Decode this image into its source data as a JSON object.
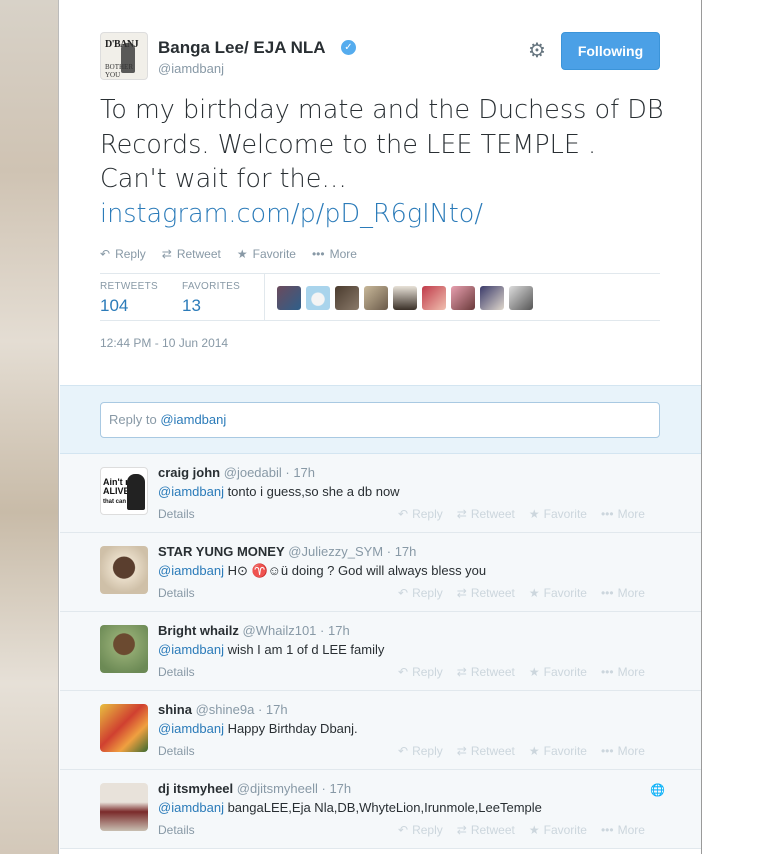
{
  "tweet": {
    "author_name": "Banga Lee/ EJA NLA",
    "author_handle": "@iamdbanj",
    "avatar_text_top": "D'BANJ",
    "avatar_text_bottom": "BOTHER YOU",
    "follow_label": "Following",
    "text_before_link": "To my birthday mate and the Duchess of DB Records. Welcome to the LEE TEMPLE . Can't wait for the… ",
    "link_text": "instagram.com/p/pD_R6gINto/",
    "actions": [
      {
        "icon": "reply-icon",
        "glyph": "↶",
        "label": "Reply"
      },
      {
        "icon": "retweet-icon",
        "glyph": "⇄",
        "label": "Retweet"
      },
      {
        "icon": "star-icon",
        "glyph": "★",
        "label": "Favorite"
      },
      {
        "icon": "more-icon",
        "glyph": "•••",
        "label": "More"
      }
    ],
    "retweets_label": "RETWEETS",
    "retweets_count": "104",
    "favorites_label": "FAVORITES",
    "favorites_count": "13",
    "timestamp": "12:44 PM - 10 Jun 2014"
  },
  "reply_box": {
    "prefix": "Reply to ",
    "mention": "@iamdbanj"
  },
  "replies": [
    {
      "name": "craig john",
      "handle": "@joedabil",
      "time": "17h",
      "mention": "@iamdbanj",
      "text": " tonto i guess,so she a db now",
      "details": "Details"
    },
    {
      "name": "STAR YUNG MONEY",
      "handle": "@Juliezzy_SYM",
      "time": "17h",
      "mention": "@iamdbanj",
      "text": " H⊙ ♈☺ü doing ? God will always bless you",
      "details": "Details"
    },
    {
      "name": "Bright whailz",
      "handle": "@Whailz101",
      "time": "17h",
      "mention": "@iamdbanj",
      "text": " wish I am 1 of d LEE family",
      "details": "Details"
    },
    {
      "name": "shina",
      "handle": "@shine9a",
      "time": "17h",
      "mention": "@iamdbanj",
      "text": " Happy Birthday Dbanj.",
      "details": "Details"
    },
    {
      "name": "dj itsmyheel",
      "handle": "@djitsmyheell",
      "time": "17h",
      "mention": "@iamdbanj",
      "text": " bangaLEE,Eja Nla,DB,WhyteLion,Irunmole,LeeTemple",
      "details": "Details"
    }
  ],
  "reply_actions": [
    {
      "glyph": "↶",
      "label": "Reply"
    },
    {
      "glyph": "⇄",
      "label": "Retweet"
    },
    {
      "glyph": "★",
      "label": "Favorite"
    },
    {
      "glyph": "•••",
      "label": "More"
    }
  ],
  "colors": {
    "link": "#2b7bb9",
    "follow_button": "#4ba0e6",
    "muted": "#8899a6"
  }
}
